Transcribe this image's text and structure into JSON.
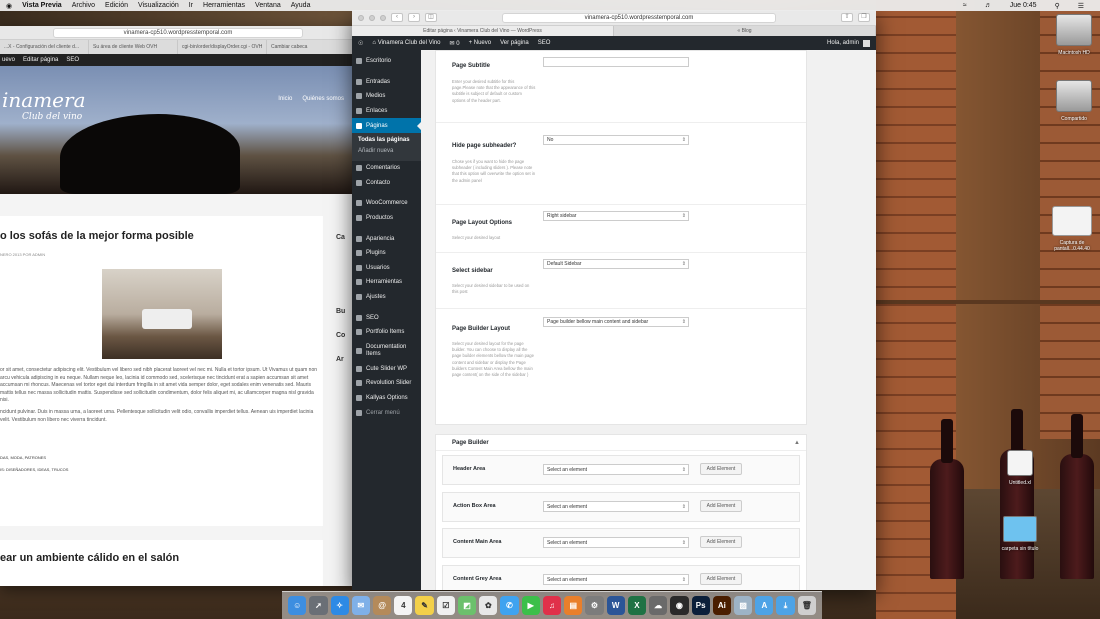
{
  "menubar": {
    "apple": "",
    "app_name": "Vista Previa",
    "items": [
      "Archivo",
      "Edición",
      "Visualización",
      "Ir",
      "Herramientas",
      "Ventana",
      "Ayuda"
    ],
    "clock": "Jue 0:45"
  },
  "left_window": {
    "url": "vinamera-cp510.wordpresstemporal.com",
    "tabs": [
      "...X - Configuración del cliente d...",
      "Su área de cliente Web OVH",
      "cgi-bin/order/displayOrder.cgi - OVH",
      "Cambiar cabeca"
    ],
    "admin_bar": [
      "uevo",
      "Editar página",
      "SEO"
    ],
    "logo": "inamera",
    "logo_sub": "Club del vino",
    "nav": [
      "Inicio",
      "Quiénes somos"
    ],
    "post_title": "o los sofás de la mejor forma posible",
    "post_meta": "NERO 2013 POR ADMIN",
    "paragraph1": "or sit amet, consectetur adipiscing elit. Vestibulum vel libero sed nibh placerat laoreet vel nec mi. Nulla et tortor ipsum. Ut Vivamus ut quam non arcu vehicula adipiscing in eu neque. Nullam neque leo, lacinia id commodo sed, scelerisque nec tincidunt erat a sapien accumsan sit amet accumsan mi rhoncus. Maecenas vel tortor eget dui interdum fringilla in sit amet vida semper dolor, eget sodales enim venenatis sed. Mauris mattis tellus nec massa sollicitudin mattis. Suspendisse sed sollicitudin condimentum, dolor felis aliquet mi, ac ullamcorper magna nisl gravida nisi.",
    "paragraph2": "ncidunt pulvinar. Duis in massa urna, a laoreet urna. Pellentesque sollicitudin velit odio, convallis imperdiet tellus. Aenean uis imperdiet lacinia velit. Vestibulum non libero nec viverra tincidunt.",
    "tags1": "DAS, MODA, PATRONES",
    "tags2": "IS: DISEÑADORES, IDEAS, TRUCOS",
    "post2_title": "ear un ambiente cálido en el salón",
    "sidebar": [
      "Ca",
      "Bu",
      "Co",
      "Ar"
    ]
  },
  "browser": {
    "url": "vinamera-cp510.wordpresstemporal.com",
    "tabs": [
      "Editar página ‹ Vinamera Club del Vino — WordPress",
      "« Blog"
    ]
  },
  "wp_admin_bar": {
    "site": "Vinamera Club del Vino",
    "comments": "0",
    "new": "+ Nuevo",
    "view": "Ver página",
    "seo": "SEO",
    "greeting": "Hola, admin"
  },
  "wp_menu": {
    "items": [
      {
        "label": "Escritorio"
      },
      {
        "label": "Entradas"
      },
      {
        "label": "Medios"
      },
      {
        "label": "Enlaces"
      },
      {
        "label": "Páginas"
      },
      {
        "label": "Comentarios"
      },
      {
        "label": "Contacto"
      },
      {
        "label": "WooCommerce"
      },
      {
        "label": "Productos"
      },
      {
        "label": "Apariencia"
      },
      {
        "label": "Plugins"
      },
      {
        "label": "Usuarios"
      },
      {
        "label": "Herramientas"
      },
      {
        "label": "Ajustes"
      },
      {
        "label": "SEO"
      },
      {
        "label": "Portfolio Items"
      },
      {
        "label": "Documentation Items"
      },
      {
        "label": "Cute Slider WP"
      },
      {
        "label": "Revolution Slider"
      },
      {
        "label": "Kallyas Options"
      },
      {
        "label": "Cerrar menú"
      }
    ],
    "sub_items": [
      "Todas las páginas",
      "Añadir nueva"
    ]
  },
  "page_options": {
    "subtitle": {
      "label": "Page Subtitle",
      "desc": "Enter your desired subtitle for this page.Please note that the appearance of this subtitle is subject of default or custom options of the header part.",
      "value": ""
    },
    "hide_subheader": {
      "label": "Hide page subheader?",
      "desc": "Chose yes if you want to hide the page subheader ( including sliders ). Please note that this option will overwrite the option set in the admin panel",
      "value": "No"
    },
    "layout": {
      "label": "Page Layout Options",
      "desc": "Select your desired layout",
      "value": "Right sidebar"
    },
    "sidebar": {
      "label": "Select sidebar",
      "desc": "Select your desired sidebar to be used on this post",
      "value": "Default Sidebar"
    },
    "builder_layout": {
      "label": "Page Builder Layout",
      "desc": "Select your desired layout for the page builder. You can choose to display all the page builder elements bellow the main page content and sidebar or display the Page builders Content Main Area bellow the main page content( on the side of the sidebar )",
      "value": "Page builder bellow main content and sidebar"
    }
  },
  "page_builder": {
    "title": "Page Builder",
    "toggle": "▲",
    "areas": [
      {
        "name": "Header Area",
        "select": "Select an element",
        "button": "Add Element"
      },
      {
        "name": "Action Box Area",
        "select": "Select an element",
        "button": "Add Element"
      },
      {
        "name": "Content Main Area",
        "select": "Select an element",
        "button": "Add Element"
      },
      {
        "name": "Content Grey Area",
        "select": "Select an element",
        "button": "Add Element"
      }
    ]
  },
  "desktop_icons": [
    {
      "label": "Macintosh HD"
    },
    {
      "label": "Compartido"
    },
    {
      "label": "Captura de pantall...0.44.40"
    },
    {
      "label": "Untitled.xl"
    },
    {
      "label": "carpeta sin título"
    }
  ],
  "dock": {
    "apps": [
      {
        "name": "Finder",
        "glyph": "☺",
        "color": "#3d8ee0"
      },
      {
        "name": "Launchpad",
        "glyph": "➚",
        "color": "#6a6f76"
      },
      {
        "name": "Safari",
        "glyph": "✧",
        "color": "#2d8ae5"
      },
      {
        "name": "Mail",
        "glyph": "✉",
        "color": "#7fb0e8"
      },
      {
        "name": "Contacts",
        "glyph": "@",
        "color": "#b48a5a"
      },
      {
        "name": "Calendar",
        "glyph": "4",
        "color": "#f4f4f4"
      },
      {
        "name": "Notes",
        "glyph": "✎",
        "color": "#f3d04a"
      },
      {
        "name": "Reminders",
        "glyph": "☑",
        "color": "#f0f0f0"
      },
      {
        "name": "Maps",
        "glyph": "◩",
        "color": "#6cc06c"
      },
      {
        "name": "Photos",
        "glyph": "✿",
        "color": "#e8e8e8"
      },
      {
        "name": "Messages",
        "glyph": "✆",
        "color": "#3fa3f0"
      },
      {
        "name": "FaceTime",
        "glyph": "▶",
        "color": "#3cbf4a"
      },
      {
        "name": "iTunes",
        "glyph": "♫",
        "color": "#e0304a"
      },
      {
        "name": "iBooks",
        "glyph": "▤",
        "color": "#e97f2b"
      },
      {
        "name": "System Preferences",
        "glyph": "⚙",
        "color": "#7c7c7c"
      },
      {
        "name": "Word",
        "glyph": "W",
        "color": "#2b5597"
      },
      {
        "name": "Excel",
        "glyph": "X",
        "color": "#1f7244"
      },
      {
        "name": "Character Viewer",
        "glyph": "☁",
        "color": "#6a6a6a"
      },
      {
        "name": "Spotify",
        "glyph": "◉",
        "color": "#2a2a2a"
      },
      {
        "name": "Photoshop",
        "glyph": "Ps",
        "color": "#0b1f3a"
      },
      {
        "name": "Illustrator",
        "glyph": "Ai",
        "color": "#4a1e00"
      },
      {
        "name": "Preview",
        "glyph": "▨",
        "color": "#9db3c6"
      },
      {
        "name": "Applications",
        "glyph": "A",
        "color": "#4da3e6"
      },
      {
        "name": "Downloads",
        "glyph": "⤓",
        "color": "#4da3e6"
      },
      {
        "name": "Trash",
        "glyph": "🗑",
        "color": "#cfcfcf"
      }
    ]
  }
}
